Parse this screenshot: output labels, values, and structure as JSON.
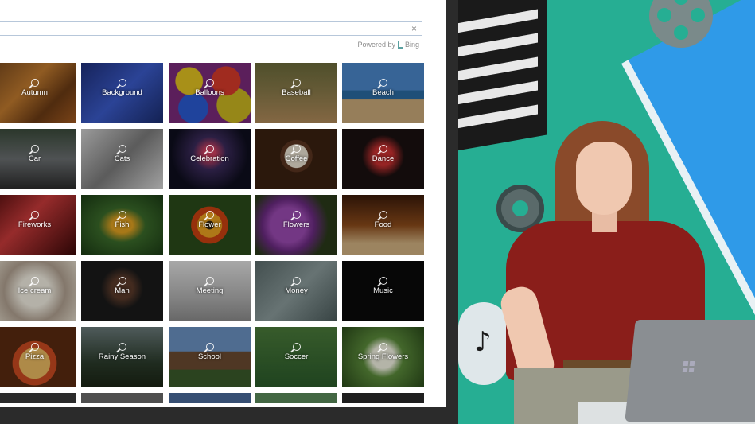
{
  "search": {
    "value": "",
    "clear_icon": "×"
  },
  "powered_by": {
    "text": "Powered by",
    "brand": "Bing"
  },
  "tiles": [
    {
      "label": "Autumn",
      "theme": "autumn"
    },
    {
      "label": "Background",
      "theme": "background"
    },
    {
      "label": "Balloons",
      "theme": "balloons"
    },
    {
      "label": "Baseball",
      "theme": "baseball"
    },
    {
      "label": "Beach",
      "theme": "beach"
    },
    {
      "label": "Car",
      "theme": "car"
    },
    {
      "label": "Cats",
      "theme": "cats"
    },
    {
      "label": "Celebration",
      "theme": "celebration"
    },
    {
      "label": "Coffee",
      "theme": "coffee"
    },
    {
      "label": "Dance",
      "theme": "dance"
    },
    {
      "label": "Fireworks",
      "theme": "fireworks"
    },
    {
      "label": "Fish",
      "theme": "fish"
    },
    {
      "label": "Flower",
      "theme": "flower"
    },
    {
      "label": "Flowers",
      "theme": "flowers"
    },
    {
      "label": "Food",
      "theme": "food"
    },
    {
      "label": "Ice cream",
      "theme": "icecream"
    },
    {
      "label": "Man",
      "theme": "man"
    },
    {
      "label": "Meeting",
      "theme": "meeting"
    },
    {
      "label": "Money",
      "theme": "money"
    },
    {
      "label": "Music",
      "theme": "music"
    },
    {
      "label": "Pizza",
      "theme": "pizza"
    },
    {
      "label": "Rainy Season",
      "theme": "rainy"
    },
    {
      "label": "School",
      "theme": "school"
    },
    {
      "label": "Soccer",
      "theme": "soccer"
    },
    {
      "label": "Spring Flowers",
      "theme": "spring"
    },
    {
      "label": "",
      "theme": "row6a"
    },
    {
      "label": "",
      "theme": "row6b"
    },
    {
      "label": "",
      "theme": "row6c"
    },
    {
      "label": "",
      "theme": "row6d"
    },
    {
      "label": "",
      "theme": "row6e"
    }
  ]
}
